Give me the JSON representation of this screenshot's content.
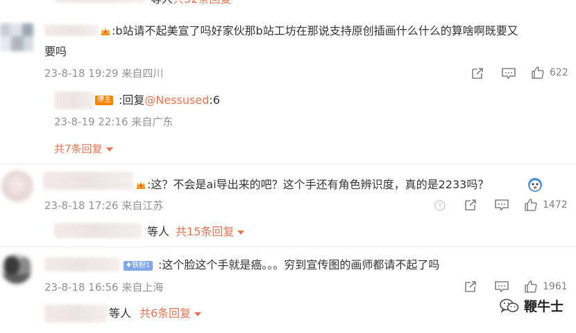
{
  "top_partial": {
    "text": "等人",
    "link": "共32条回复"
  },
  "comments": [
    {
      "content_prefix": ":b站请不起美宣了吗好家伙那b站工坊在那说支持原创插画什么什么的算啥啊既要又",
      "content_line2": "要吗",
      "time": "23-8-18 19:29",
      "location": "来自四川",
      "likes": "622",
      "sub_reply": {
        "badge": "博主",
        "prefix": ":回复",
        "mention": "@Nessused",
        "suffix": ":6",
        "time": "23-8-19 22:16",
        "location": "来自广东"
      },
      "more": "共7条回复"
    },
    {
      "content": ":这？不会是ai导出来的吧？这个手还有角色辨识度，真的是2233吗？",
      "time": "23-8-18 17:26",
      "location": "来自江苏",
      "likes": "1472",
      "reply_text": "等人",
      "more": "共15条回复"
    },
    {
      "fan_badge": "铁粉1",
      "content": ":这个脸这个手就是癌。。。穷到宣传图的画师都请不起了吗",
      "time": "23-8-18 16:56",
      "location": "来自上海",
      "likes": "1961",
      "reply_text": "等人",
      "more": "共6条回复"
    }
  ],
  "watermark": "鞭牛士",
  "colors": {
    "accent": "#eb7350",
    "meta": "#939393",
    "text": "#333333"
  }
}
